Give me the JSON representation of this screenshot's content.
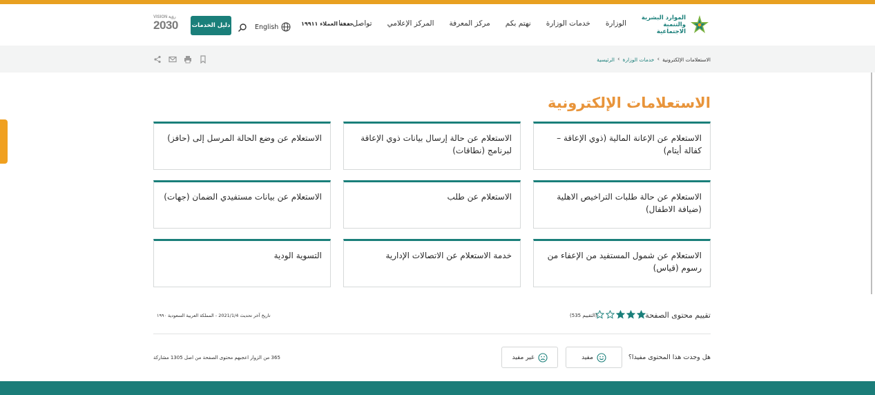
{
  "header": {
    "logo_text": "الموارد البشرية والتنمية الاجتماعية",
    "nav": [
      "الوزارة",
      "خدمات الوزارة",
      "نهتم بكم",
      "مركز المعرفة",
      "المركز الإعلامي",
      "تواصل معنا"
    ],
    "hotline": "خدمة العملاء ١٩٩١١",
    "language": "English",
    "guide_button": "دليل الخدمات",
    "vision_brand": "2030",
    "vision_top": "VISION رؤية"
  },
  "breadcrumb": {
    "items": [
      "الرئيسية",
      "خدمات الوزارة",
      "الاستعلامات الإلكترونية"
    ]
  },
  "page": {
    "title": "الاستعلامات الإلكترونية"
  },
  "cards": [
    "الاستعلام عن الإعانة المالية (ذوي الإعاقة – كفالة أيتام)",
    "الاستعلام عن حالة إرسال بيانات ذوي الإعاقة لبرنامج (نطاقات)",
    "الاستعلام عن وضع الحالة المرسل إلى (حافز)",
    "الاستعلام عن حالة طلبات التراخيص الاهلية (ضيافة الاطفال)",
    "الاستعلام عن طلب",
    "الاستعلام عن بيانات مستفيدي الضمان (جهات)",
    "الاستعلام عن شمول المستفيد من الإعفاء من رسوم (قياس)",
    "خدمة الاستعلام عن الاتصالات الإدارية",
    "التسوية الودية"
  ],
  "rating": {
    "label": "تقييم محتوى الصفحة",
    "value": 3,
    "max": 5,
    "count_text": "(التقييم 535)",
    "star_color": "#1a7f7a"
  },
  "updated": "تاريخ آخر تحديث 2021/1/4 - المملكة العربية السعودية ١٩٩٠",
  "feedback": {
    "question": "هل وجدت هذا المحتوى مفيدا؟",
    "helpful": "مفيد",
    "not_helpful": "غير مفيد",
    "visitors_text": "365 من الزوار اعجبهم محتوى الصفحة من اصل 1305 مشاركة"
  },
  "colors": {
    "brand": "#1a7f7a",
    "accent": "#e8943a",
    "top_line": "#e8a020"
  }
}
